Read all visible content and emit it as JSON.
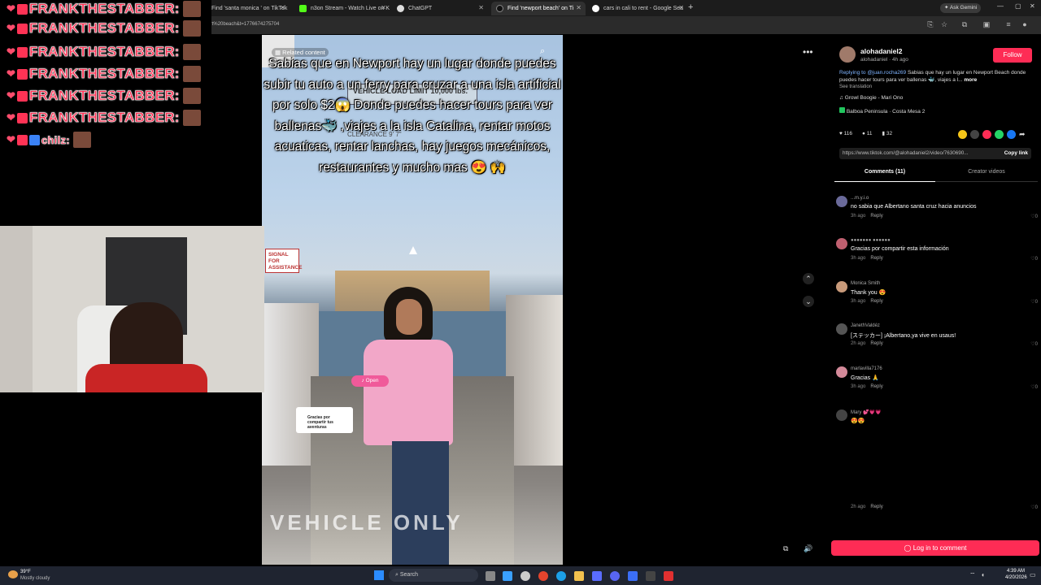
{
  "browser": {
    "tabs": [
      {
        "label": "Find 'santa monica ' on TikTok",
        "active": false
      },
      {
        "label": "n3on Stream - Watch Live on K",
        "active": false
      },
      {
        "label": "ChatGPT",
        "active": false
      },
      {
        "label": "Find 'newport beach' on Ti",
        "active": true
      },
      {
        "label": "cars in cali to rent - Google Sea",
        "active": false
      }
    ],
    "ask_gemini": "Ask Gemini",
    "url": "tiktok.com/@alohadaniel2/video/7630690...4274387q=newport%20beach&t=1776674275704"
  },
  "stream_chat": {
    "rows": [
      {
        "name": "FRANKTHESTABBER:"
      },
      {
        "name": "FRANKTHESTABBER:"
      },
      {
        "name": "FRANKTHESTABBER:"
      },
      {
        "name": "FRANKTHESTABBER:"
      },
      {
        "name": "FRANKTHESTABBER:"
      },
      {
        "name": "FRANKTHESTABBER:"
      }
    ],
    "last_name": "chilz:"
  },
  "video": {
    "related_label": "Related content",
    "caption": "Sabias que en Newport hay un lugar donde puedes subir tu auto a un ferry para cruzar a una isla artificial por solo $2😱 Donde puedes hacer tours para ver ballenas🐳 ,viajes a la isla Catalina, rentar motos acuaticas, rentar lanchas, hay juegos mecánicos, restaurantes y mucho mas 😍 🙌",
    "sign_load_limit": "VEHICLE LOAD LIMIT 10,000 lbs.",
    "sign_clearance": "CLEARANCE 9' 7\"",
    "sign_signal": "SIGNAL FOR ASSISTANCE",
    "open_badge": "Open",
    "reply_card": "Gracias por compartir tus aventuras",
    "ground_text": "VEHICLE ONLY"
  },
  "post": {
    "author": "alohadaniel2",
    "author_sub": "alohadaniel · 4h ago",
    "follow_label": "Follow",
    "reply_to": "Replying to @juan.rocha269",
    "description": "Sabias que hay un lugar en Newport Beach donde puedes hacer tours para ver ballenas 🐳, viajes a l...",
    "more_label": "more",
    "see_translation": "See translation",
    "music": "Growl Boogie - Mari Ono",
    "location": "Balboa Peninsula · Costa Mesa",
    "location_count": "2",
    "likes": "116",
    "comments": "11",
    "saves": "32",
    "link": "https://www.tiktok.com/@alohadaniel2/video/7630690...",
    "copy_link": "Copy link",
    "tab_comments": "Comments (11)",
    "tab_creator": "Creator videos",
    "login_comment": "Log in to comment"
  },
  "comments": [
    {
      "user": "...m.y.i.o",
      "text": "no sabia que Albertano santa cruz hacia anuncios",
      "time": "3h ago",
      "likes": "0",
      "color": "#6a6a9a"
    },
    {
      "user": "●●●●●●● ●●●●●●",
      "text": "Gracias por compartir esta información",
      "time": "3h ago",
      "likes": "0",
      "color": "#c06070"
    },
    {
      "user": "Monica Smith",
      "text": "Thank you 😍",
      "time": "3h ago",
      "likes": "0",
      "color": "#c89a7a"
    },
    {
      "user": "JanethValdéz",
      "text": "[ステッカー] ¡Albertano,ya vive en usaus!",
      "time": "2h ago",
      "likes": "0",
      "color": "#555555"
    },
    {
      "user": "marlavilla7176",
      "text": "Gracias 🙏",
      "time": "3h ago",
      "likes": "0",
      "color": "#d48a9a"
    },
    {
      "user": "Mary 💕💗💗",
      "text": "😍😍",
      "time": "",
      "likes": "",
      "color": "#444444"
    },
    {
      "user": "",
      "text": "",
      "time": "2h ago",
      "likes": "0",
      "color": "#000000"
    }
  ],
  "reply_label": "Reply",
  "taskbar": {
    "weather_temp": "39°F",
    "weather_desc": "Mostly cloudy",
    "search_label": "Search",
    "time": "4:39 AM",
    "date": "4/20/2026"
  },
  "colors": {
    "tiktok_red": "#fe2c55",
    "chat_red": "#ff3355"
  }
}
